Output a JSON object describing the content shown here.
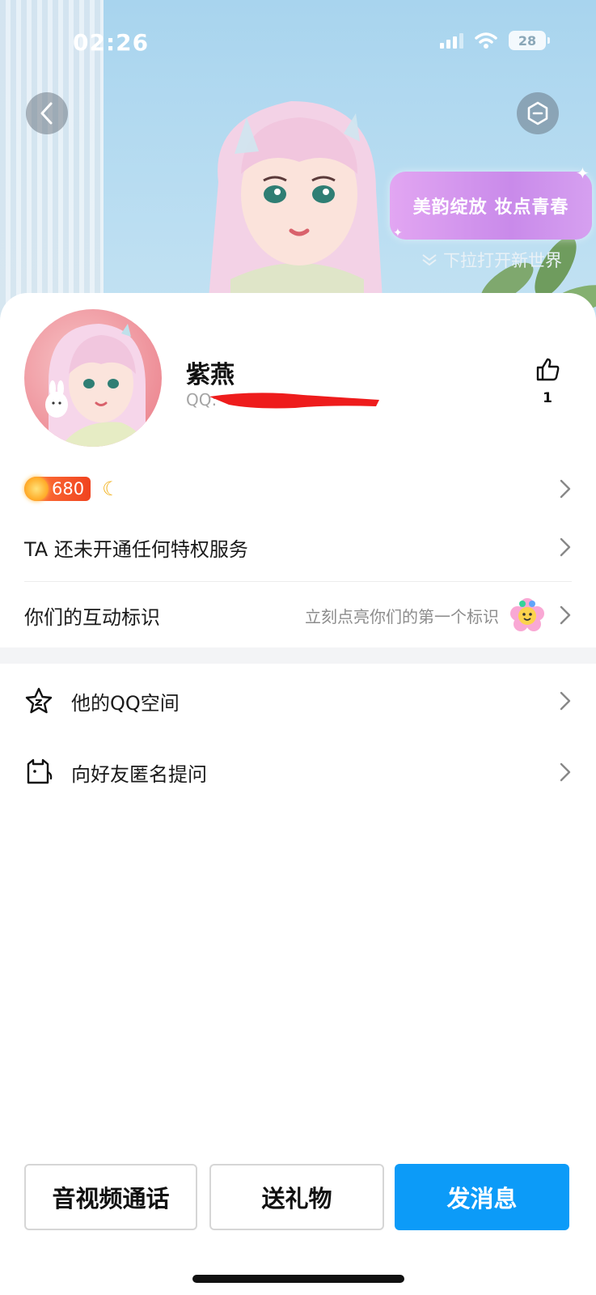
{
  "status_bar": {
    "time": "02:26",
    "battery": "28"
  },
  "hero": {
    "promo_text": "美韵绽放 妆点青春",
    "pull_hint": "下拉打开新世界"
  },
  "profile": {
    "nickname": "紫燕",
    "qq_label": "QQ:",
    "like_count": "1",
    "level": "680"
  },
  "rows": {
    "privilege": "TA 还未开通任何特权服务",
    "interaction_title": "你们的互动标识",
    "interaction_hint": "立刻点亮你们的第一个标识",
    "qzone": "他的QQ空间",
    "anonymous_ask": "向好友匿名提问"
  },
  "actions": {
    "call": "音视频通话",
    "gift": "送礼物",
    "message": "发消息"
  },
  "colors": {
    "primary": "#0c9bf8",
    "promo": "#c98aea",
    "level": "#f0431f"
  }
}
